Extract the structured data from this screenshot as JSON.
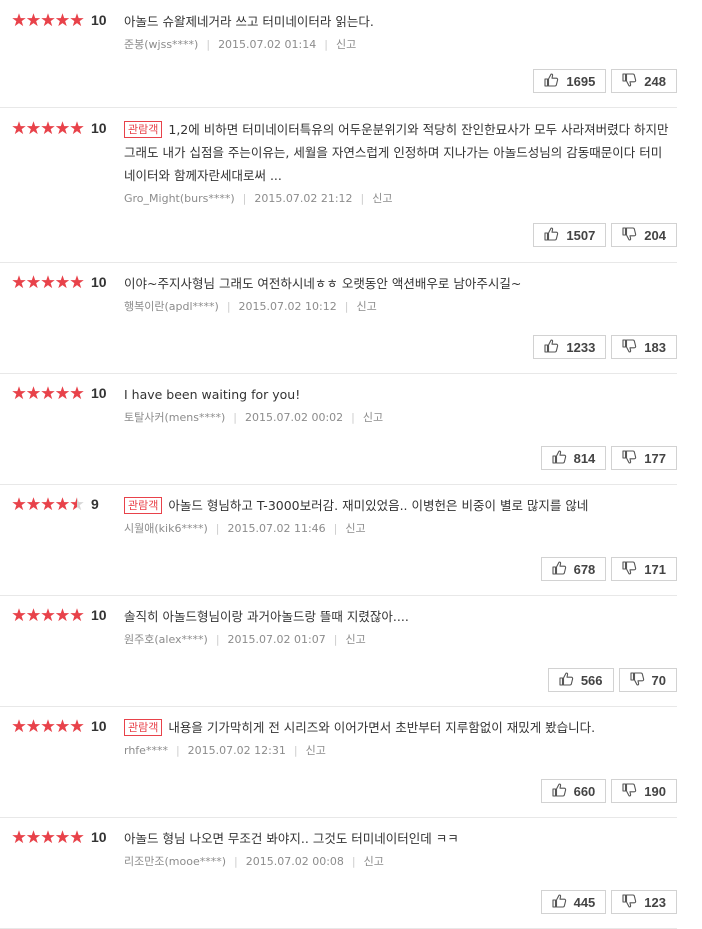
{
  "colors": {
    "star": "#e8424a",
    "badge": "#e8424a",
    "meta": "#8c8c8c"
  },
  "icons": {
    "like": "thumbs-up-icon",
    "dislike": "thumbs-down-icon",
    "star": "star-icon"
  },
  "reviews": [
    {
      "rating": 5,
      "score": "10",
      "badge": "",
      "text": "아놀드 슈왈제네거라 쓰고 터미네이터라 읽는다.",
      "user": "준봉(wjss****)",
      "date": "2015.07.02 01:14",
      "report": "신고",
      "likes": "1695",
      "dislikes": "248"
    },
    {
      "rating": 5,
      "score": "10",
      "badge": "관람객",
      "text": "1,2에 비하면 터미네이터특유의 어두운분위기와 적당히 잔인한묘사가 모두 사라져버렸다 하지만 그래도 내가 십점을 주는이유는, 세월을 자연스럽게 인정하며 지나가는 아놀드성님의 감동때문이다 터미네이터와 함께자란세대로써 ...",
      "user": "Gro_Might(burs****)",
      "date": "2015.07.02 21:12",
      "report": "신고",
      "likes": "1507",
      "dislikes": "204"
    },
    {
      "rating": 5,
      "score": "10",
      "badge": "",
      "text": "이야~주지사형님 그래도 여전하시네ㅎㅎ 오랫동안 액션배우로 남아주시길~",
      "user": "행복이란(apdl****)",
      "date": "2015.07.02 10:12",
      "report": "신고",
      "likes": "1233",
      "dislikes": "183"
    },
    {
      "rating": 5,
      "score": "10",
      "badge": "",
      "text": "I have been waiting for you!",
      "user": "토탈사커(mens****)",
      "date": "2015.07.02 00:02",
      "report": "신고",
      "likes": "814",
      "dislikes": "177"
    },
    {
      "rating": 4.5,
      "score": "9",
      "badge": "관람객",
      "text": "아놀드 형님하고 T-3000보러감. 재미있었음.. 이병헌은 비중이 별로 많지를 않네",
      "user": "시월애(kik6****)",
      "date": "2015.07.02 11:46",
      "report": "신고",
      "likes": "678",
      "dislikes": "171"
    },
    {
      "rating": 5,
      "score": "10",
      "badge": "",
      "text": "솔직히 아놀드형님이랑 과거아놀드랑 뜰때 지렸잖아....",
      "user": "원주호(alex****)",
      "date": "2015.07.02 01:07",
      "report": "신고",
      "likes": "566",
      "dislikes": "70"
    },
    {
      "rating": 5,
      "score": "10",
      "badge": "관람객",
      "text": "내용을 기가막히게 전 시리즈와 이어가면서 초반부터 지루함없이 재밌게 봤습니다.",
      "user": "rhfe****",
      "date": "2015.07.02 12:31",
      "report": "신고",
      "likes": "660",
      "dislikes": "190"
    },
    {
      "rating": 5,
      "score": "10",
      "badge": "",
      "text": "아놀드 형님 나오면 무조건 봐야지.. 그것도 터미네이터인데 ㅋㅋ",
      "user": "리조만조(mooe****)",
      "date": "2015.07.02 00:08",
      "report": "신고",
      "likes": "445",
      "dislikes": "123"
    }
  ]
}
